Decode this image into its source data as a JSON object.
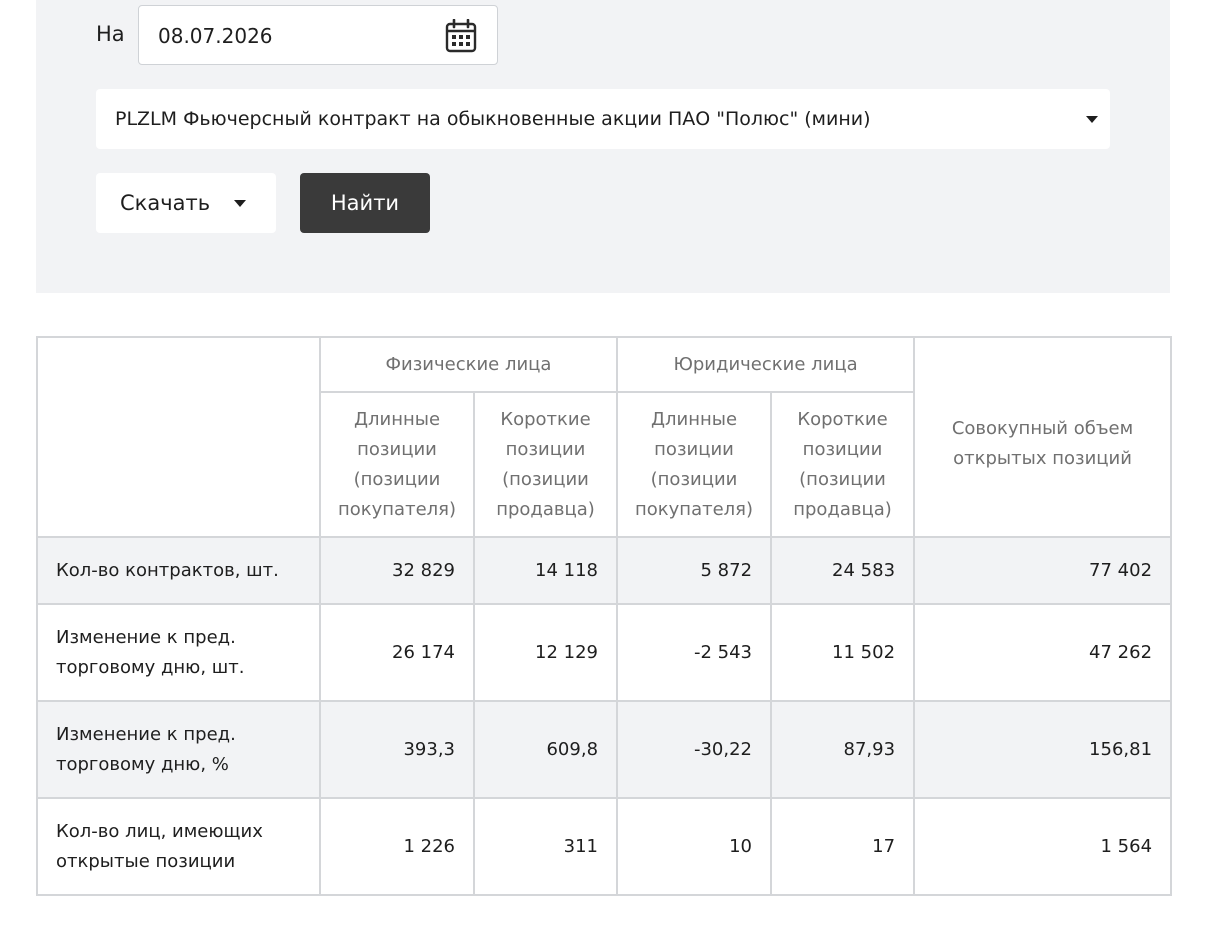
{
  "filters": {
    "date_label": "На",
    "date_value": "08.07.2026",
    "date_icon": "calendar-icon",
    "instrument_value": "PLZLM Фьючерсный контракт на обыкновенные акции ПАО \"Полюс\" (мини)",
    "instrument_icon": "chevron-down-icon",
    "download_label": "Скачать",
    "find_label": "Найти"
  },
  "table": {
    "groups": {
      "individuals": "Физические лица",
      "legal": "Юридические лица",
      "total": "Совокупный объем открытых позиций"
    },
    "subheaders": {
      "ind_long": "Длинные позиции (позиции покупателя)",
      "ind_short": "Короткие позиции (позиции продавца)",
      "leg_long": "Длинные позиции (позиции покупателя)",
      "leg_short": "Короткие позиции (позиции продавца)"
    },
    "rows": [
      {
        "label": "Кол-во контрактов, шт.",
        "ind_long": "32 829",
        "ind_short": "14 118",
        "leg_long": "5 872",
        "leg_short": "24 583",
        "total": "77 402"
      },
      {
        "label": "Изменение к пред. торговому дню, шт.",
        "ind_long": "26 174",
        "ind_short": "12 129",
        "leg_long": "-2 543",
        "leg_short": "11 502",
        "total": "47 262"
      },
      {
        "label": "Изменение к пред. торговому дню, %",
        "ind_long": "393,3",
        "ind_short": "609,8",
        "leg_long": "-30,22",
        "leg_short": "87,93",
        "total": "156,81"
      },
      {
        "label": "Кол-во лиц, имеющих открытые позиции",
        "ind_long": "1 226",
        "ind_short": "311",
        "leg_long": "10",
        "leg_short": "17",
        "total": "1 564"
      }
    ]
  },
  "colors": {
    "panel_bg": "#f2f3f5",
    "button_dark": "#3a3a3a",
    "border": "#d4d6d9",
    "header_text": "#707070"
  }
}
